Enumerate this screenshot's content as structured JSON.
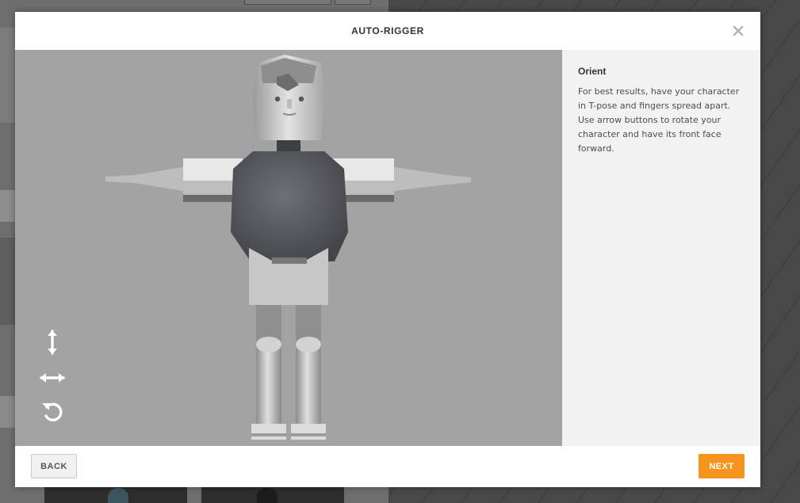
{
  "modal": {
    "title": "AUTO-RIGGER",
    "close_icon": "close-icon"
  },
  "panel": {
    "heading": "Orient",
    "text": "For best results, have your character in T-pose and fingers spread apart. Use arrow buttons to rotate your character and have its front face forward."
  },
  "controls": [
    {
      "name": "rotate-vertical-button",
      "icon": "vertical-arrows-icon"
    },
    {
      "name": "rotate-horizontal-button",
      "icon": "horizontal-arrows-icon"
    },
    {
      "name": "reset-rotation-button",
      "icon": "rotate-ccw-icon"
    }
  ],
  "footer": {
    "back_label": "BACK",
    "next_label": "NEXT"
  },
  "colors": {
    "accent": "#f7941d",
    "viewport_bg": "#a3a3a3",
    "panel_bg": "#f2f2f2"
  }
}
